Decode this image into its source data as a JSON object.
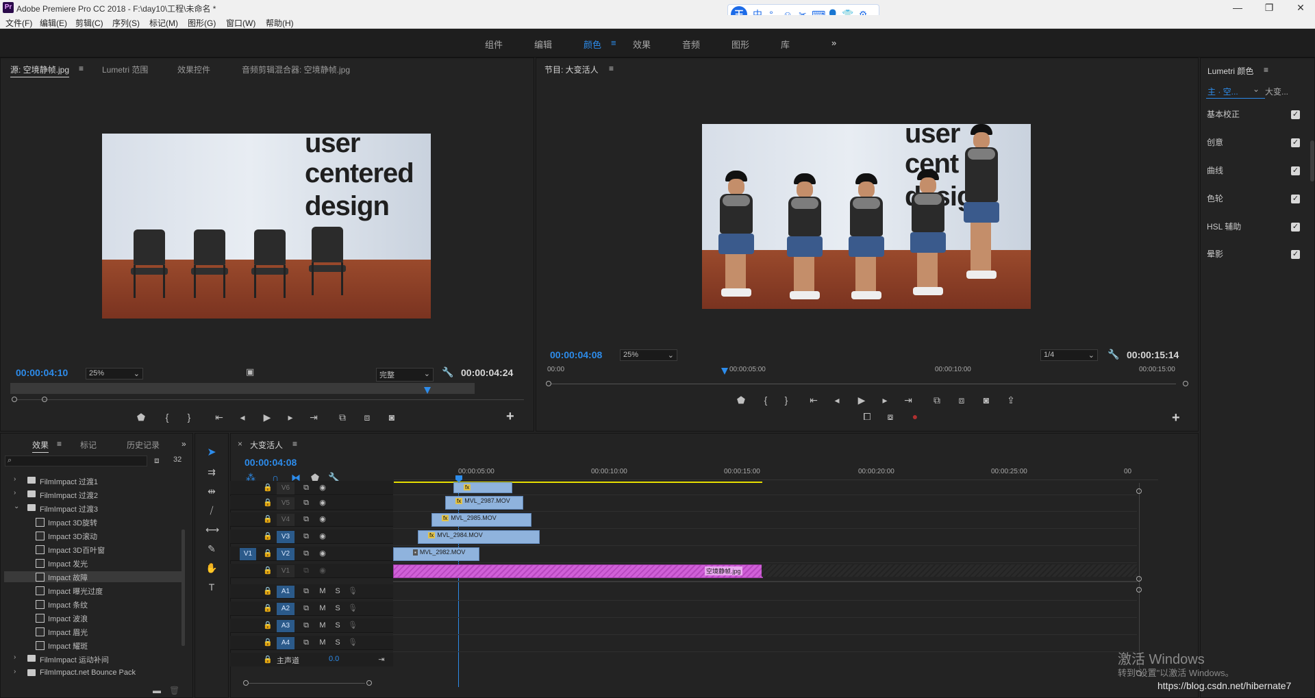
{
  "window": {
    "title": "Adobe Premiere Pro CC 2018 - F:\\day10\\工程\\未命名 *",
    "logo": "Pr",
    "controls": [
      "—",
      "❐",
      "✕"
    ]
  },
  "ime": {
    "logo": "王",
    "items": [
      "中",
      "°,",
      "☺",
      "✂",
      "⌨",
      "👤",
      "👕",
      "⚙"
    ]
  },
  "menubar": [
    "文件(F)",
    "编辑(E)",
    "剪辑(C)",
    "序列(S)",
    "标记(M)",
    "图形(G)",
    "窗口(W)",
    "帮助(H)"
  ],
  "workspaces": {
    "items": [
      "组件",
      "编辑",
      "颜色",
      "效果",
      "音频",
      "图形",
      "库"
    ],
    "active": "颜色",
    "more": "»"
  },
  "source": {
    "tabs": [
      "源: 空境静帧.jpg",
      "Lumetri 范围",
      "效果控件",
      "音频剪辑混合器: 空境静帧.jpg"
    ],
    "timecode_in": "00:00:04:10",
    "timecode_dur": "00:00:04:24",
    "zoom": "25%",
    "quality": "完整",
    "frame_text": [
      "user",
      "centered",
      "design"
    ]
  },
  "program": {
    "tab": "节目: 大变活人",
    "timecode": "00:00:04:08",
    "duration": "00:00:15:14",
    "zoom": "25%",
    "resolution": "1/4",
    "ruler": [
      "00:00",
      "00:00:05:00",
      "00:00:10:00",
      "00:00:15:00"
    ],
    "frame_text": [
      "user",
      "cent",
      "desig"
    ]
  },
  "lumetri": {
    "title": "Lumetri 颜色",
    "sel_left": "主 · 空...",
    "sel_right": "大变...",
    "sections": [
      "基本校正",
      "创意",
      "曲线",
      "色轮",
      "HSL 辅助",
      "晕影"
    ]
  },
  "effects": {
    "tabs": [
      "效果",
      "标记",
      "历史记录"
    ],
    "tree": [
      {
        "type": "folder",
        "label": "FilmImpact 过渡1",
        "open": false
      },
      {
        "type": "folder",
        "label": "FilmImpact 过渡2",
        "open": false
      },
      {
        "type": "folder",
        "label": "FilmImpact 过渡3",
        "open": true
      },
      {
        "type": "fx",
        "label": "Impact 3D旋转"
      },
      {
        "type": "fx",
        "label": "Impact 3D滚动"
      },
      {
        "type": "fx",
        "label": "Impact 3D百叶窗"
      },
      {
        "type": "fx",
        "label": "Impact 发光"
      },
      {
        "type": "fx",
        "label": "Impact 故障",
        "selected": true
      },
      {
        "type": "fx",
        "label": "Impact 曝光过度"
      },
      {
        "type": "fx",
        "label": "Impact 条纹"
      },
      {
        "type": "fx",
        "label": "Impact 波浪"
      },
      {
        "type": "fx",
        "label": "Impact 眉光"
      },
      {
        "type": "fx",
        "label": "Impact 耀斑"
      },
      {
        "type": "folder",
        "label": "FilmImpact 运动补间",
        "open": false
      },
      {
        "type": "folder",
        "label": "FilmImpact.net Bounce Pack",
        "open": false
      }
    ]
  },
  "timeline": {
    "tab": "大变活人",
    "timecode": "00:00:04:08",
    "ruler": [
      "00:00:05:00",
      "00:00:10:00",
      "00:00:15:00",
      "00:00:20:00",
      "00:00:25:00",
      "00"
    ],
    "video_tracks": [
      "V6",
      "V5",
      "V4",
      "V3",
      "V2",
      "V1"
    ],
    "audio_tracks": [
      "A1",
      "A2",
      "A3",
      "A4"
    ],
    "master": "主声道",
    "master_value": "0.0",
    "src_patch": "V1",
    "clips": [
      {
        "track": "V5",
        "label": "MVL_2987.MOV"
      },
      {
        "track": "V4",
        "label": "MVL_2985.MOV"
      },
      {
        "track": "V3",
        "label": "MVL_2984.MOV"
      },
      {
        "track": "V2",
        "label": "MVL_2982.MOV"
      },
      {
        "track": "V1",
        "label": "空境静帧.jpg"
      }
    ]
  },
  "watermark": {
    "line1": "激活 Windows",
    "line2": "转到\"设置\"以激活 Windows。",
    "url": "https://blog.csdn.net/hibernate7"
  }
}
